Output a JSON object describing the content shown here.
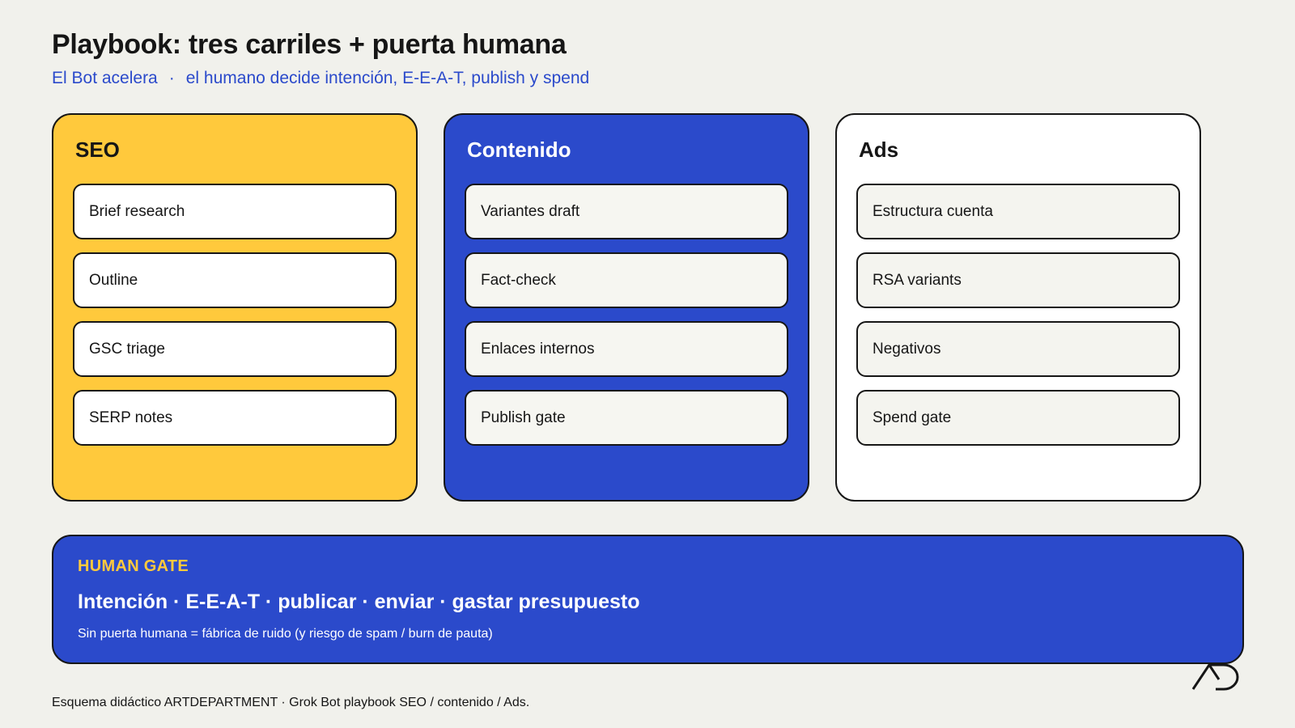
{
  "header": {
    "title": "Playbook: tres carriles + puerta humana",
    "subtitle_left": "El Bot acelera",
    "subtitle_sep": "·",
    "subtitle_right": "el humano decide intención, E-E-A-T, publish y spend"
  },
  "lanes": [
    {
      "title": "SEO",
      "color": "#FFC93C",
      "items": [
        "Brief research",
        "Outline",
        "GSC triage",
        "SERP notes"
      ]
    },
    {
      "title": "Contenido",
      "color": "#2B4ACB",
      "items": [
        "Variantes draft",
        "Fact-check",
        "Enlaces internos",
        "Publish gate"
      ]
    },
    {
      "title": "Ads",
      "color": "#FFFFFF",
      "items": [
        "Estructura cuenta",
        "RSA variants",
        "Negativos",
        "Spend gate"
      ]
    }
  ],
  "gate": {
    "label": "HUMAN GATE",
    "main": "Intención · E-E-A-T · publicar · enviar · gastar presupuesto",
    "note": "Sin puerta humana = fábrica de ruido (y riesgo de spam / burn de pauta)",
    "color": "#2B4ACB",
    "label_color": "#FFC93C"
  },
  "logo": {
    "icon": "artdepartment-logo-icon"
  },
  "footer": {
    "text": "Esquema didáctico ARTDEPARTMENT · Grok Bot playbook SEO / contenido / Ads."
  }
}
